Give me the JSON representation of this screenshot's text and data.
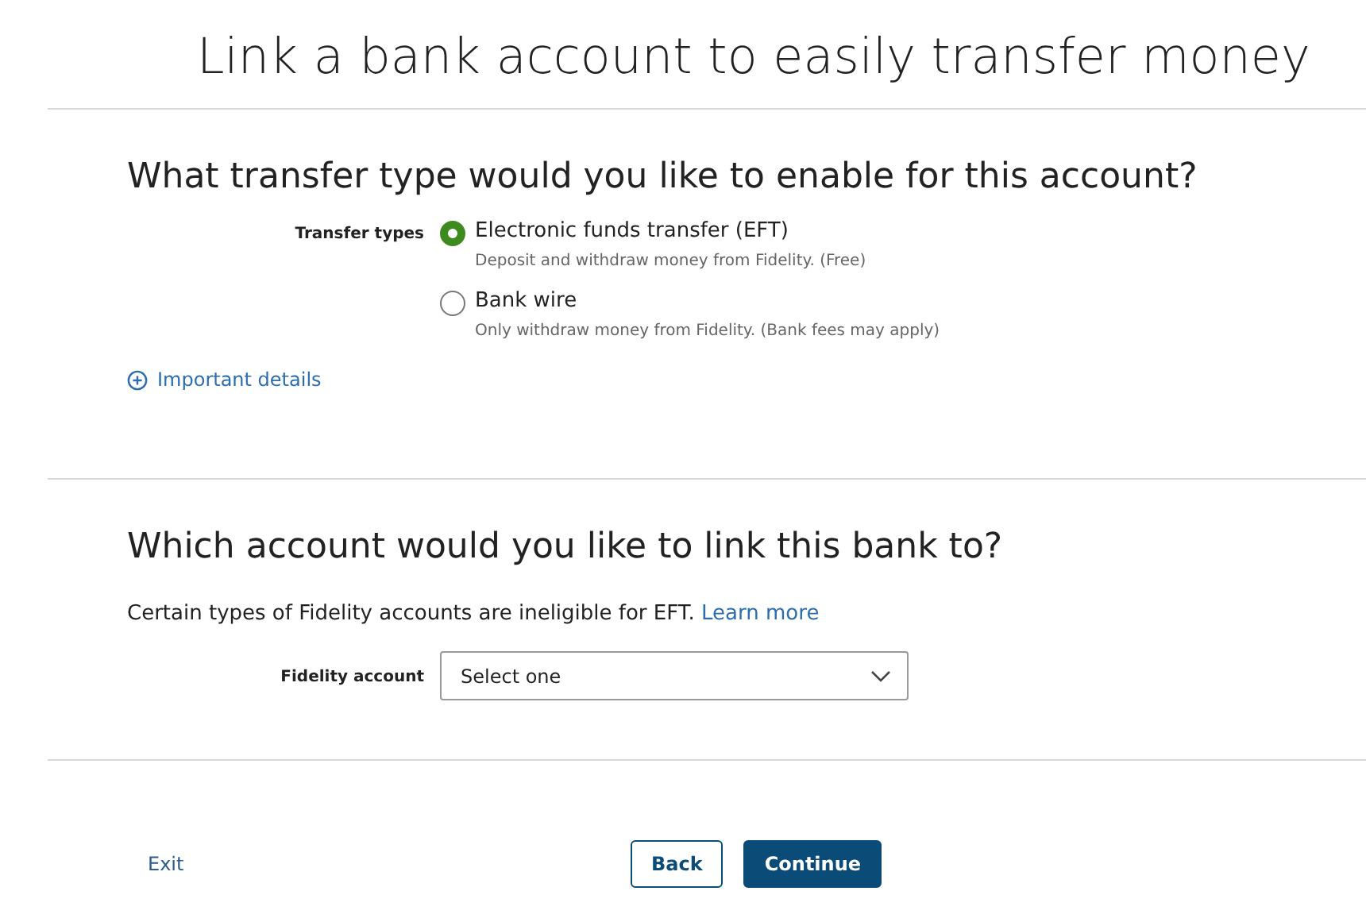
{
  "page_title": "Link a bank account to easily transfer money",
  "transfer_section": {
    "heading": "What transfer type would you like to enable for this account?",
    "label": "Transfer types",
    "options": [
      {
        "label": "Electronic funds transfer (EFT)",
        "description": "Deposit and withdraw money from Fidelity. (Free)",
        "selected": true
      },
      {
        "label": "Bank wire",
        "description": "Only withdraw money from Fidelity. (Bank fees may apply)",
        "selected": false
      }
    ],
    "details_link": "Important details"
  },
  "account_section": {
    "heading": "Which account would you like to link this bank to?",
    "note": "Certain types of Fidelity accounts are ineligible for EFT.",
    "note_link": "Learn more",
    "field_label": "Fidelity account",
    "select_placeholder": "Select one"
  },
  "footer": {
    "exit": "Exit",
    "back": "Back",
    "continue": "Continue"
  }
}
